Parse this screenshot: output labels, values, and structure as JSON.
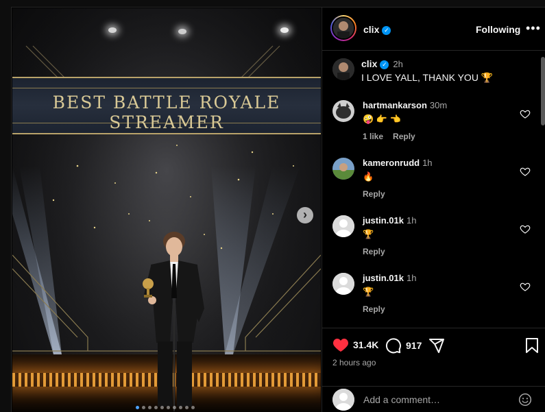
{
  "post": {
    "username": "clix",
    "follow_label": "Following",
    "more_label": "•••",
    "caption": {
      "username": "clix",
      "time": "2h",
      "text": "I LOVE YALL, THANK YOU 🏆"
    },
    "media": {
      "banner_text": "BEST BATTLE ROYALE STREAMER",
      "next_label": "›",
      "slide_count": 10,
      "active_slide": 0
    }
  },
  "comments": [
    {
      "username": "hartmankarson",
      "time": "30m",
      "text": "🤪 👉 👈",
      "likes_label": "1 like",
      "reply_label": "Reply"
    },
    {
      "username": "kameronrudd",
      "time": "1h",
      "text": "🔥",
      "likes_label": "",
      "reply_label": "Reply"
    },
    {
      "username": "justin.01k",
      "time": "1h",
      "text": "🏆",
      "likes_label": "",
      "reply_label": "Reply"
    },
    {
      "username": "justin.01k",
      "time": "1h",
      "text": "🏆",
      "likes_label": "",
      "reply_label": "Reply"
    }
  ],
  "stats": {
    "likes": "31.4K",
    "comments": "917",
    "posted_ago": "2 hours ago"
  },
  "add_comment": {
    "placeholder": "Add a comment…"
  },
  "colors": {
    "like_red": "#ff3040",
    "verified_blue": "#0095f6",
    "banner_gold": "#d9c996"
  }
}
